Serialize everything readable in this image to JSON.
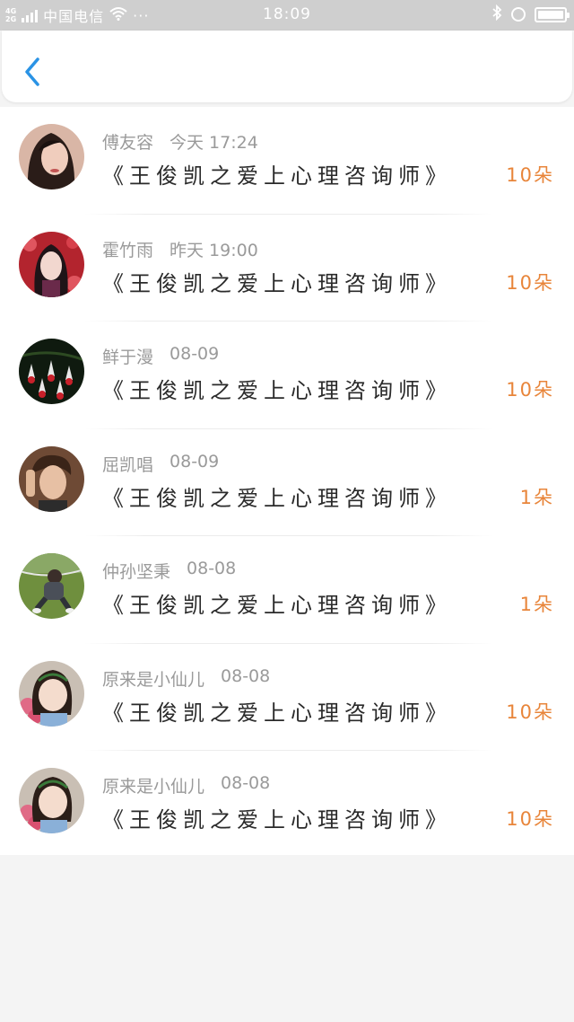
{
  "status_bar": {
    "network": "4G",
    "network_sub": "2G",
    "carrier": "中国电信",
    "wifi_icon": "wifi-icon",
    "more": "···",
    "time": "18:09",
    "battery_level": 1.0
  },
  "header": {
    "back_icon": "chevron-left-icon",
    "accent_color": "#2a93e5"
  },
  "colors": {
    "count": "#e8853a",
    "name": "#9a9a9a",
    "title": "#2a2a2a"
  },
  "items": [
    {
      "name": "傅友容",
      "date": "今天 17:24",
      "title": "《王俊凯之爱上心理咨询师》",
      "count": "10朵",
      "avatar": "avatar-girl-dark-hair"
    },
    {
      "name": "霍竹雨",
      "date": "昨天 19:00",
      "title": "《王俊凯之爱上心理咨询师》",
      "count": "10朵",
      "avatar": "avatar-woman-red-flowers"
    },
    {
      "name": "鲜于漫",
      "date": "08-09",
      "title": "《王俊凯之爱上心理咨询师》",
      "count": "10朵",
      "avatar": "avatar-fuchsia-flowers"
    },
    {
      "name": "屈凯唱",
      "date": "08-09",
      "title": "《王俊凯之爱上心理咨询师》",
      "count": "1朵",
      "avatar": "avatar-young-man"
    },
    {
      "name": "仲孙坚秉",
      "date": "08-08",
      "title": "《王俊凯之爱上心理咨询师》",
      "count": "1朵",
      "avatar": "avatar-person-on-grass"
    },
    {
      "name": "原来是小仙儿",
      "date": "08-08",
      "title": "《王俊凯之爱上心理咨询师》",
      "count": "10朵",
      "avatar": "avatar-little-girl"
    },
    {
      "name": "原来是小仙儿",
      "date": "08-08",
      "title": "《王俊凯之爱上心理咨询师》",
      "count": "10朵",
      "avatar": "avatar-little-girl"
    }
  ]
}
